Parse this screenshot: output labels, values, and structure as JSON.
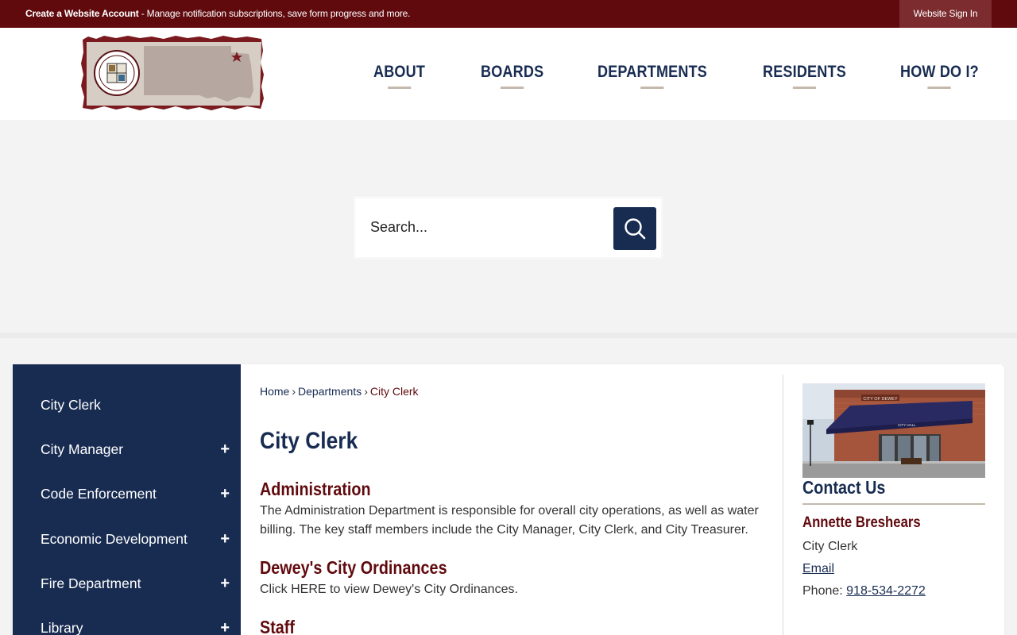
{
  "topbar": {
    "account_bold": "Create a Website Account",
    "account_rest": " - Manage notification subscriptions, save form progress and more.",
    "signin_label": "Website Sign In"
  },
  "header": {
    "logo": {
      "line1": "CITY OF",
      "line2": "DEWEY",
      "line3": "OKLAHOMA"
    },
    "nav": [
      "ABOUT",
      "BOARDS",
      "DEPARTMENTS",
      "RESIDENTS",
      "HOW DO I?"
    ]
  },
  "search": {
    "placeholder": "Search..."
  },
  "sidebar": {
    "items": [
      {
        "label": "City Clerk",
        "expandable": false
      },
      {
        "label": "City Manager",
        "expandable": true
      },
      {
        "label": "Code Enforcement",
        "expandable": true
      },
      {
        "label": "Economic Development",
        "expandable": true
      },
      {
        "label": "Fire Department",
        "expandable": true
      },
      {
        "label": "Library",
        "expandable": true
      }
    ],
    "expand_symbol": "+"
  },
  "breadcrumb": {
    "home": "Home",
    "sep": "›",
    "section": "Departments",
    "current": "City Clerk"
  },
  "main": {
    "title": "City Clerk",
    "sections": [
      {
        "title": "Administration",
        "text": "The Administration Department is responsible for overall city operations, as well as water billing. The key staff members include the City Manager, City Clerk, and City Treasurer."
      },
      {
        "title": "Dewey's City Ordinances",
        "text": "Click HERE to view Dewey's City Ordinances."
      },
      {
        "title": "Staff",
        "text": ""
      }
    ]
  },
  "contact": {
    "title": "Contact Us",
    "name": "Annette Breshears",
    "role": "City Clerk",
    "email_label": "Email",
    "phone_label": "Phone: ",
    "phone": "918-534-2272",
    "photo_sign": "CITY OF DEWEY",
    "photo_awning": "CITY HALL"
  },
  "colors": {
    "maroon": "#600a0e",
    "navy": "#182c52",
    "accent_tan": "#c4b9ac",
    "background": "#f3f3f3"
  },
  "icons": {
    "search": "search-icon",
    "expand": "plus-icon"
  }
}
